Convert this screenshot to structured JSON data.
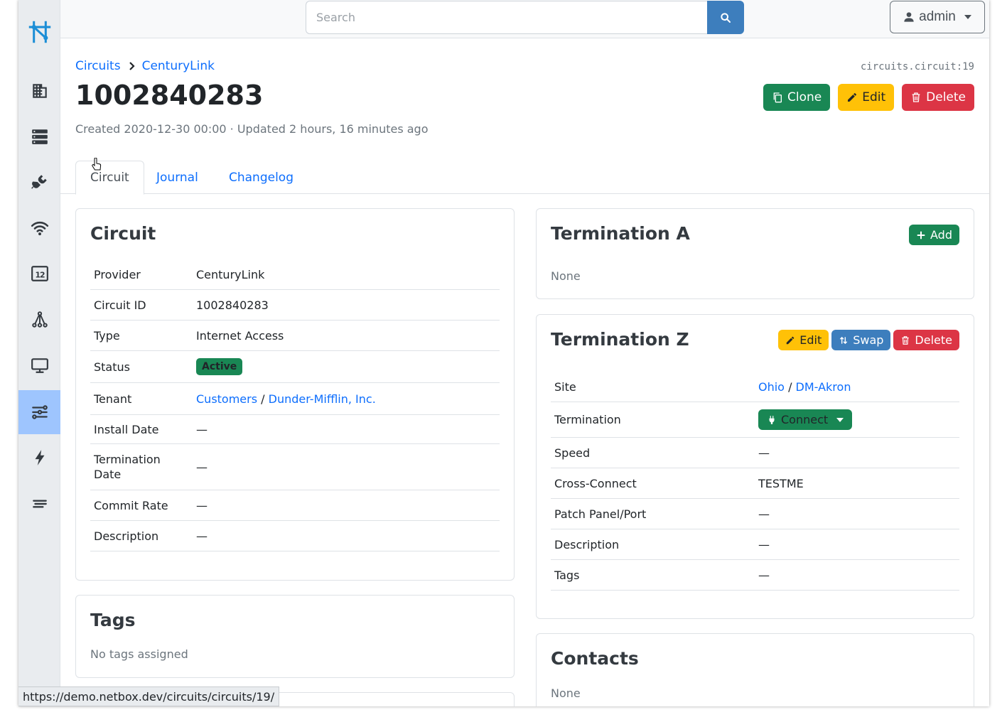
{
  "topbar": {
    "search_placeholder": "Search",
    "user_label": "admin"
  },
  "sidebar": {
    "items": [
      {
        "icon": "netbox-logo-icon"
      },
      {
        "icon": "organization-icon"
      },
      {
        "icon": "devices-icon"
      },
      {
        "icon": "connections-icon"
      },
      {
        "icon": "wireless-icon"
      },
      {
        "icon": "ipam-icon"
      },
      {
        "icon": "overlay-icon"
      },
      {
        "icon": "virtualization-icon"
      },
      {
        "icon": "circuits-icon",
        "active": true
      },
      {
        "icon": "power-icon"
      },
      {
        "icon": "other-icon"
      }
    ]
  },
  "breadcrumb": {
    "items": [
      "Circuits",
      "CenturyLink"
    ]
  },
  "object_id": "circuits.circuit:19",
  "page_title": "1002840283",
  "meta": "Created 2020-12-30 00:00 · Updated 2 hours, 16 minutes ago",
  "actions": {
    "clone": "Clone",
    "edit": "Edit",
    "delete": "Delete"
  },
  "tabs": [
    "Circuit",
    "Journal",
    "Changelog"
  ],
  "circuit_card": {
    "title": "Circuit",
    "rows": {
      "provider": {
        "label": "Provider",
        "value": "CenturyLink"
      },
      "circuit_id": {
        "label": "Circuit ID",
        "value": "1002840283"
      },
      "type": {
        "label": "Type",
        "value": "Internet Access"
      },
      "status": {
        "label": "Status",
        "value": "Active"
      },
      "tenant": {
        "label": "Tenant",
        "group": "Customers",
        "sep": "/",
        "value": "Dunder-Mifflin, Inc."
      },
      "install_date": {
        "label": "Install Date",
        "value": "—"
      },
      "termination_date": {
        "label_line1": "Termination",
        "label_line2": "Date",
        "value": "—"
      },
      "commit_rate": {
        "label": "Commit Rate",
        "value": "—"
      },
      "description": {
        "label": "Description",
        "value": "—"
      }
    }
  },
  "tags_card": {
    "title": "Tags",
    "empty": "No tags assigned"
  },
  "term_a": {
    "title": "Termination A",
    "add": "Add",
    "empty": "None"
  },
  "term_z": {
    "title": "Termination Z",
    "edit": "Edit",
    "swap": "Swap",
    "delete": "Delete",
    "rows": {
      "site": {
        "label": "Site",
        "region": "Ohio",
        "sep": "/",
        "value": "DM-Akron"
      },
      "termination": {
        "label": "Termination",
        "value": "Connect"
      },
      "speed": {
        "label": "Speed",
        "value": "—"
      },
      "cross_connect": {
        "label": "Cross-Connect",
        "value": "TESTME"
      },
      "patch_panel": {
        "label": "Patch Panel/Port",
        "value": "—"
      },
      "description": {
        "label": "Description",
        "value": "—"
      },
      "tags": {
        "label": "Tags",
        "value": "—"
      }
    }
  },
  "contacts_card": {
    "title": "Contacts",
    "empty": "None"
  },
  "status_url": "https://demo.netbox.dev/circuits/circuits/19/",
  "colors": {
    "link": "#0d6efd",
    "success": "#198754",
    "warning": "#ffc107",
    "danger": "#dc3545",
    "primary": "#3d7ebd",
    "sidebar_active": "#9ec5fe"
  }
}
